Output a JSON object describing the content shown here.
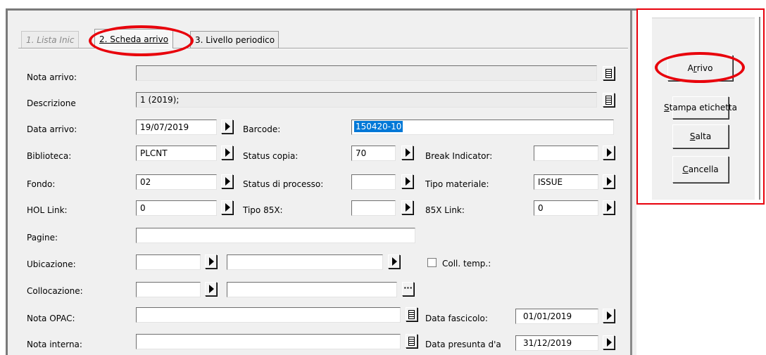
{
  "tabs": [
    {
      "label": "1. Lista Inic"
    },
    {
      "label": "2. Scheda arrivo"
    },
    {
      "label": "3. Livello periodico"
    }
  ],
  "form": {
    "nota_arrivo": {
      "label": "Nota arrivo:",
      "value": ""
    },
    "descrizione": {
      "label": "Descrizione",
      "value": "1 (2019);"
    },
    "data_arrivo": {
      "label": "Data arrivo:",
      "value": "19/07/2019"
    },
    "barcode": {
      "label": "Barcode:",
      "value": "150420-10"
    },
    "biblioteca": {
      "label": "Biblioteca:",
      "value": "PLCNT"
    },
    "status_copia": {
      "label": "Status copia:",
      "value": "70"
    },
    "break_indicator": {
      "label": "Break Indicator:",
      "value": ""
    },
    "fondo": {
      "label": "Fondo:",
      "value": "02"
    },
    "status_processo": {
      "label": "Status di processo:",
      "value": ""
    },
    "tipo_materiale": {
      "label": "Tipo materiale:",
      "value": "ISSUE"
    },
    "hol_link": {
      "label": "HOL Link:",
      "value": "0"
    },
    "tipo_85x": {
      "label": "Tipo 85X:",
      "value": ""
    },
    "link_85x": {
      "label": "85X Link:",
      "value": "0"
    },
    "pagine": {
      "label": "Pagine:",
      "value": ""
    },
    "ubicazione": {
      "label": "Ubicazione:",
      "value1": "",
      "value2": ""
    },
    "coll_temp": {
      "label": "Coll. temp.:",
      "checked": false
    },
    "collocazione": {
      "label": "Collocazione:",
      "value1": "",
      "value2": ""
    },
    "nota_opac": {
      "label": "Nota OPAC:",
      "value": ""
    },
    "data_fascicolo": {
      "label": "Data fascicolo:",
      "value": "01/01/2019"
    },
    "nota_interna": {
      "label": "Nota interna:",
      "value": ""
    },
    "data_presunta": {
      "label": "Data presunta d'a",
      "value": "31/12/2019"
    }
  },
  "side": {
    "arrivo_pre": "A",
    "arrivo_u": "r",
    "arrivo_post": "rivo",
    "stampa_u": "S",
    "stampa_post": "tampa etichetta",
    "salta_u": "S",
    "salta_post": "alta",
    "cancella_u": "C",
    "cancella_post": "ancella"
  },
  "colors": {
    "highlight": "#e8000b",
    "selection": "#0078d7"
  }
}
